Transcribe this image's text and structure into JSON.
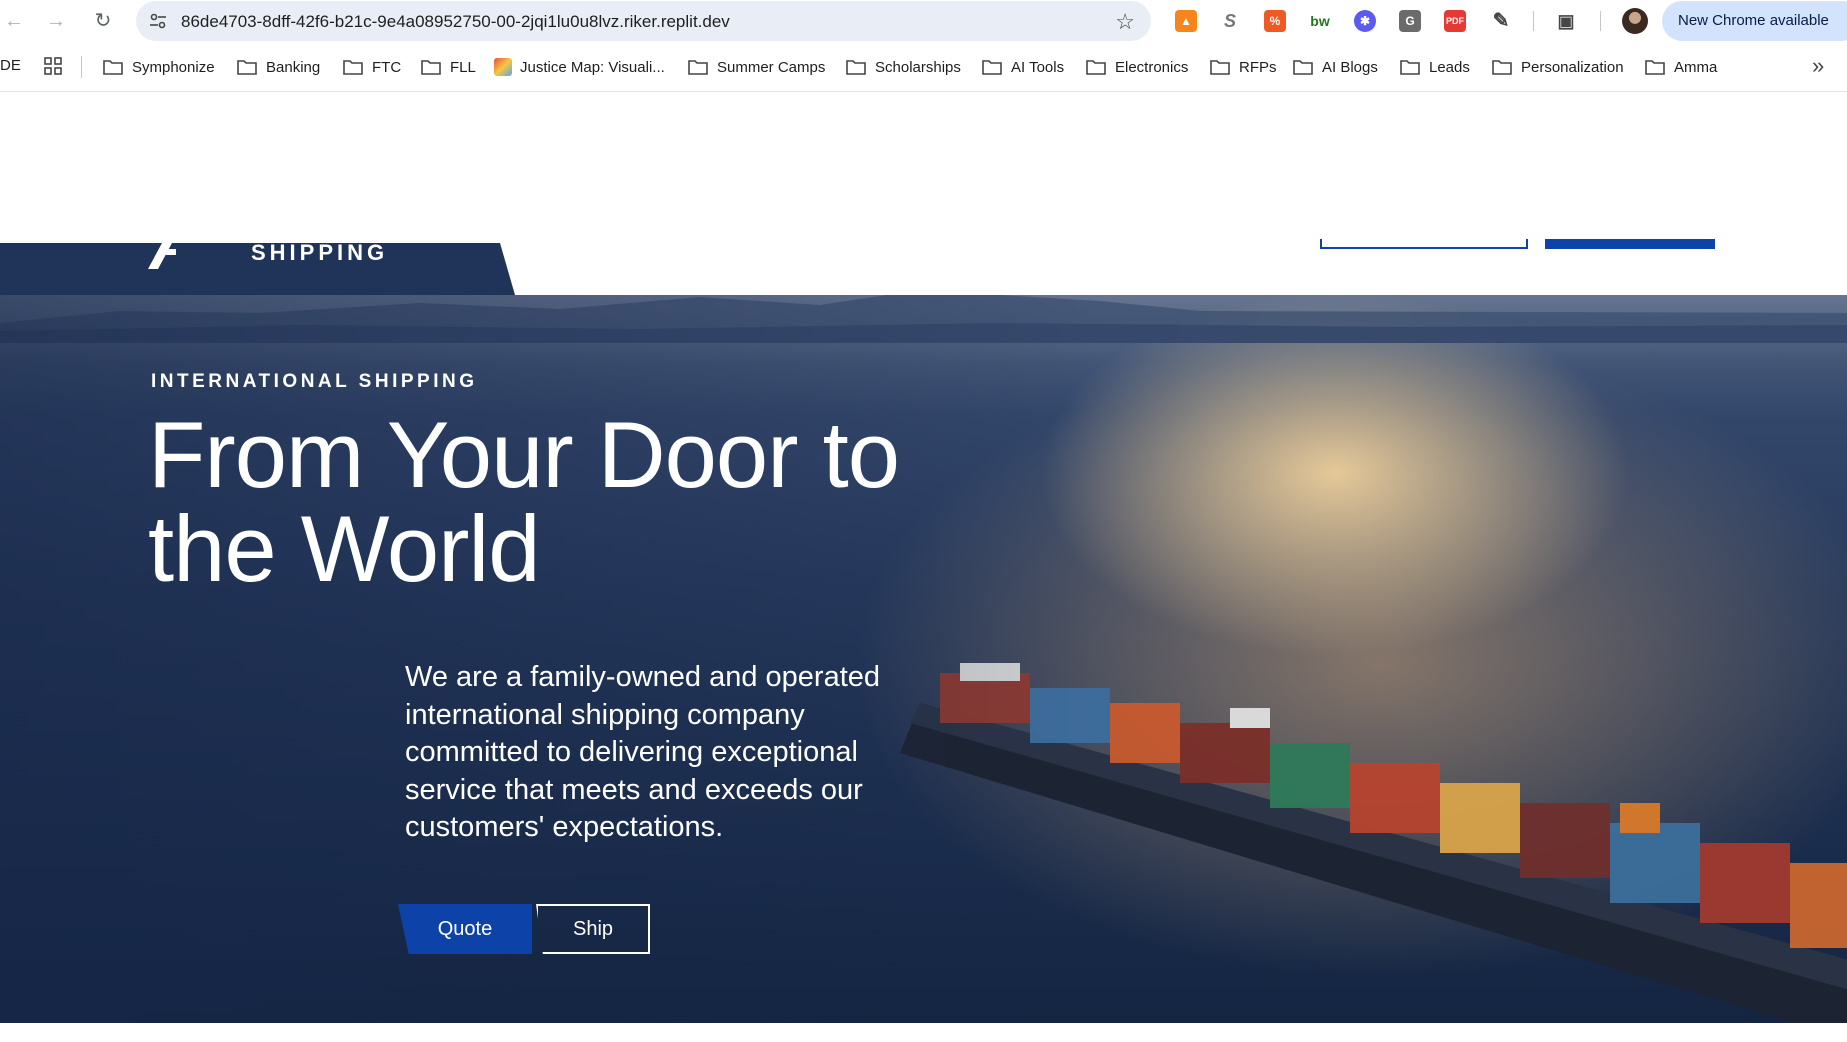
{
  "browser": {
    "url": "86de4703-8dff-42f6-b21c-9e4a08952750-00-2jqi1lu0u8lvz.riker.replit.dev",
    "update_label": "New Chrome available",
    "extensions": [
      "metamask-icon",
      "s-icon",
      "percent-icon",
      "bw-icon",
      "snowflake-icon",
      "g-icon",
      "pdf-icon",
      "puzzle-icon"
    ]
  },
  "bookmarks": {
    "leading": "DE",
    "items": [
      {
        "label": "Symphonize",
        "icon": "folder-icon"
      },
      {
        "label": "Banking",
        "icon": "folder-icon"
      },
      {
        "label": "FTC",
        "icon": "folder-icon"
      },
      {
        "label": "FLL",
        "icon": "folder-icon"
      },
      {
        "label": "Justice Map: Visuali...",
        "icon": "map-favicon"
      },
      {
        "label": "Summer Camps",
        "icon": "folder-icon"
      },
      {
        "label": "Scholarships",
        "icon": "folder-icon"
      },
      {
        "label": "AI Tools",
        "icon": "folder-icon"
      },
      {
        "label": "Electronics",
        "icon": "folder-icon"
      },
      {
        "label": "RFPs",
        "icon": "folder-icon"
      },
      {
        "label": "AI Blogs",
        "icon": "folder-icon"
      },
      {
        "label": "Leads",
        "icon": "folder-icon"
      },
      {
        "label": "Personalization",
        "icon": "folder-icon"
      },
      {
        "label": "Amma",
        "icon": "folder-icon"
      }
    ]
  },
  "site": {
    "logo_text": "SHIPPING",
    "accent_color": "#0d43a8",
    "hero": {
      "eyebrow": "INTERNATIONAL SHIPPING",
      "headline_line1": "From Your Door to",
      "headline_line2": "the World",
      "lead": "We are a family-owned and operated international shipping company committed to delivering exceptional service that meets and exceeds our customers' expectations.",
      "quote_label": "Quote",
      "ship_label": "Ship"
    }
  }
}
